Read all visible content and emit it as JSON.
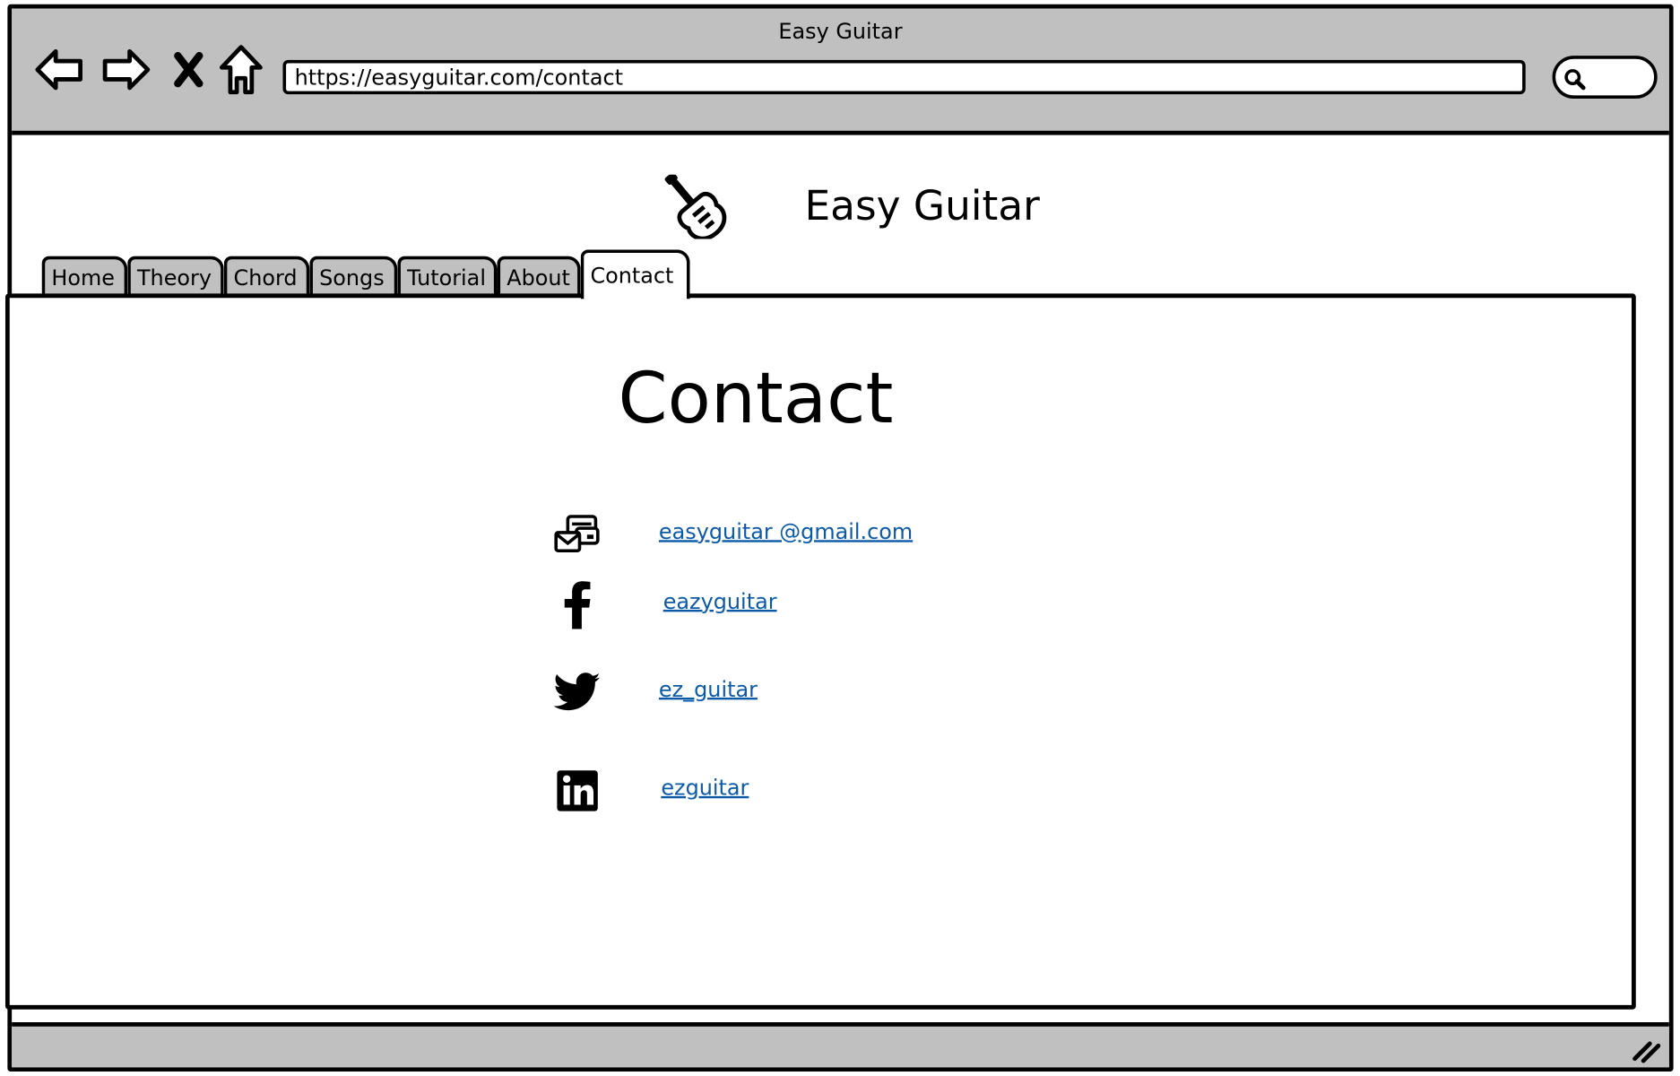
{
  "window": {
    "title": "Easy Guitar"
  },
  "toolbar": {
    "back_icon": "arrow-left-icon",
    "forward_icon": "arrow-right-icon",
    "stop_icon": "close-icon",
    "home_icon": "home-icon",
    "url": "https://easyguitar.com/contact",
    "search_icon": "search-icon"
  },
  "site": {
    "logo_icon": "electric-guitar-icon",
    "title": "Easy Guitar"
  },
  "tabs": [
    {
      "label": "Home",
      "active": false
    },
    {
      "label": "Theory",
      "active": false
    },
    {
      "label": "Chord",
      "active": false
    },
    {
      "label": "Songs",
      "active": false
    },
    {
      "label": "Tutorial",
      "active": false
    },
    {
      "label": "About",
      "active": false
    },
    {
      "label": "Contact",
      "active": true
    }
  ],
  "main": {
    "heading": "Contact",
    "contacts": [
      {
        "icon": "email-icon",
        "text": "easyguitar @gmail.com"
      },
      {
        "icon": "facebook-icon",
        "text": "eazyguitar"
      },
      {
        "icon": "twitter-icon",
        "text": "ez_guitar"
      },
      {
        "icon": "linkedin-icon",
        "text": "ezguitar"
      }
    ]
  },
  "colors": {
    "chrome": "#c0c0c0",
    "link": "#0a5aa8",
    "outline": "#000000"
  }
}
